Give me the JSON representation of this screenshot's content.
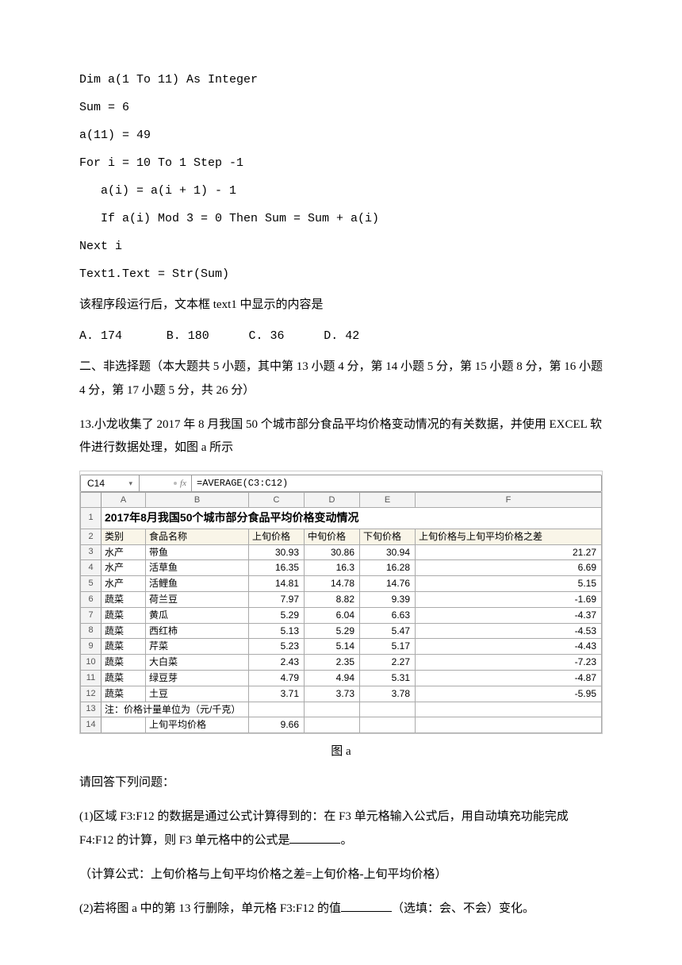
{
  "code": {
    "l1": "Dim a(1 To 11) As Integer",
    "l2": "Sum = 6",
    "l3": "a(11) = 49",
    "l4": "For i = 10 To 1 Step -1",
    "l5": "   a(i) = a(i + 1) - 1",
    "l6": "   If a(i) Mod 3 = 0 Then Sum = Sum + a(i)",
    "l7": "Next i",
    "l8": "Text1.Text = Str(Sum)"
  },
  "q_prompt": "该程序段运行后，文本框 text1 中显示的内容是",
  "options": {
    "a": "A. 174",
    "b": "B. 180",
    "c": "C. 36",
    "d": "D. 42"
  },
  "section2": "二、非选择题（本大题共 5 小题，其中第 13 小题 4 分，第 14 小题 5 分，第 15 小题 8 分，第 16 小题 4 分，第 17 小题 5 分，共 26 分）",
  "q13_intro": "13.小龙收集了 2017 年 8 月我国 50 个城市部分食品平均价格变动情况的有关数据，并使用 EXCEL 软件进行数据处理，如图 a 所示",
  "excel": {
    "namebox": "C14",
    "fx": "fx",
    "formula": "=AVERAGE(C3:C12)",
    "cols": [
      "",
      "A",
      "B",
      "C",
      "D",
      "E",
      "F"
    ],
    "title": "2017年8月我国50个城市部分食品平均价格变动情况",
    "headers": [
      "类别",
      "食品名称",
      "上旬价格",
      "中旬价格",
      "下旬价格",
      "上旬价格与上旬平均价格之差"
    ],
    "rows": [
      {
        "n": "3",
        "a": "水产",
        "b": "带鱼",
        "c": "30.93",
        "d": "30.86",
        "e": "30.94",
        "f": "21.27"
      },
      {
        "n": "4",
        "a": "水产",
        "b": "活草鱼",
        "c": "16.35",
        "d": "16.3",
        "e": "16.28",
        "f": "6.69"
      },
      {
        "n": "5",
        "a": "水产",
        "b": "活鲤鱼",
        "c": "14.81",
        "d": "14.78",
        "e": "14.76",
        "f": "5.15"
      },
      {
        "n": "6",
        "a": "蔬菜",
        "b": "荷兰豆",
        "c": "7.97",
        "d": "8.82",
        "e": "9.39",
        "f": "-1.69"
      },
      {
        "n": "7",
        "a": "蔬菜",
        "b": "黄瓜",
        "c": "5.29",
        "d": "6.04",
        "e": "6.63",
        "f": "-4.37"
      },
      {
        "n": "8",
        "a": "蔬菜",
        "b": "西红柿",
        "c": "5.13",
        "d": "5.29",
        "e": "5.47",
        "f": "-4.53"
      },
      {
        "n": "9",
        "a": "蔬菜",
        "b": "芹菜",
        "c": "5.23",
        "d": "5.14",
        "e": "5.17",
        "f": "-4.43"
      },
      {
        "n": "10",
        "a": "蔬菜",
        "b": "大白菜",
        "c": "2.43",
        "d": "2.35",
        "e": "2.27",
        "f": "-7.23"
      },
      {
        "n": "11",
        "a": "蔬菜",
        "b": "绿豆芽",
        "c": "4.79",
        "d": "4.94",
        "e": "5.31",
        "f": "-4.87"
      },
      {
        "n": "12",
        "a": "蔬菜",
        "b": "土豆",
        "c": "3.71",
        "d": "3.73",
        "e": "3.78",
        "f": "-5.95"
      }
    ],
    "note_row": {
      "n": "13",
      "text": "注：价格计量单位为（元/千克）"
    },
    "avg_row": {
      "n": "14",
      "b": "上旬平均价格",
      "c": "9.66"
    }
  },
  "caption": "图 a",
  "q_followup": "请回答下列问题：",
  "q1": {
    "pre": "(1)区域 F3:F12 的数据是通过公式计算得到的：在 F3 单元格输入公式后，用自动填充功能完成 F4:F12 的计算，则 F3 单元格中的公式是",
    "post": "。"
  },
  "q1_note": "（计算公式：上旬价格与上旬平均价格之差=上旬价格-上旬平均价格）",
  "q2": {
    "pre": "(2)若将图 a 中的第 13 行删除，单元格 F3:F12 的值",
    "post": "（选填：会、不会）变化。"
  }
}
